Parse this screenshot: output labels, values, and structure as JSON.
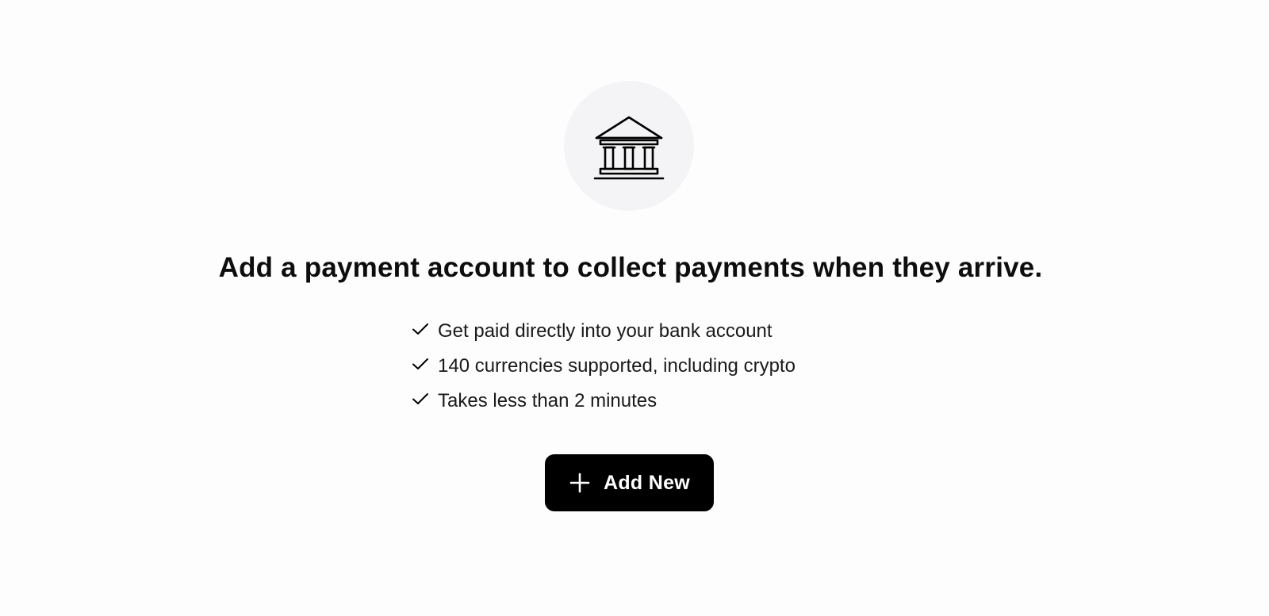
{
  "empty_state": {
    "icon": "bank-icon",
    "headline": "Add a payment account to collect payments when they arrive.",
    "features": [
      {
        "icon": "check-icon",
        "text": "Get paid directly into your bank account"
      },
      {
        "icon": "check-icon",
        "text": "140 currencies supported, including crypto"
      },
      {
        "icon": "check-icon",
        "text": "Takes less than 2 minutes"
      }
    ],
    "add_button": {
      "icon": "plus-icon",
      "label": "Add New"
    }
  },
  "colors": {
    "background": "#fefdfe",
    "icon_circle": "#f4f4f6",
    "button_background": "#000000",
    "button_text": "#ffffff",
    "text": "#111111"
  }
}
